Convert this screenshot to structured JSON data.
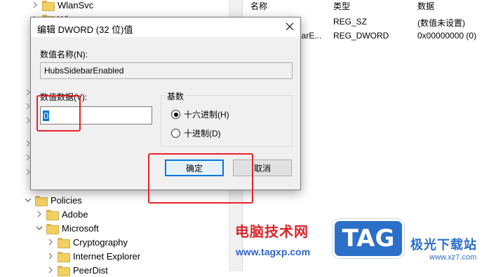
{
  "registry": {
    "tree_top": [
      {
        "label": "WlanSvc"
      },
      {
        "label": "Wl..."
      }
    ],
    "tree_bottom": [
      {
        "label": "Policies",
        "expanded": true
      },
      {
        "label": "Adobe",
        "expanded": false
      },
      {
        "label": "Microsoft",
        "expanded": true
      },
      {
        "label": "Cryptography",
        "expanded": false
      },
      {
        "label": "Internet Explorer",
        "expanded": false
      },
      {
        "label": "PeerDist",
        "expanded": false
      }
    ],
    "columns": [
      "名称",
      "类型",
      "数据"
    ],
    "rows": [
      {
        "name": "",
        "type": "REG_SZ",
        "data": "(数值未设置)"
      },
      {
        "name": "barE...",
        "type": "REG_DWORD",
        "data": "0x00000000 (0)"
      }
    ]
  },
  "dialog": {
    "title": "编辑 DWORD (32 位)值",
    "value_name_label": "数值名称(N):",
    "value_name": "HubsSidebarEnabled",
    "value_data_label": "数值数据(V):",
    "value_data": "0",
    "base_label": "基数",
    "radios": [
      {
        "label": "十六进制(H)",
        "checked": true
      },
      {
        "label": "十进制(D)",
        "checked": false
      }
    ],
    "ok_label": "确定",
    "cancel_label": "取消"
  },
  "watermark": {
    "cn_text": "电脑技术网",
    "url": "www.tagxp.com",
    "logo_text": "TAG",
    "site_name": "极光下载站",
    "site_url": "www.xz7.com"
  },
  "colors": {
    "annotation_red": "#e8222a",
    "accent_blue": "#0078d7"
  }
}
